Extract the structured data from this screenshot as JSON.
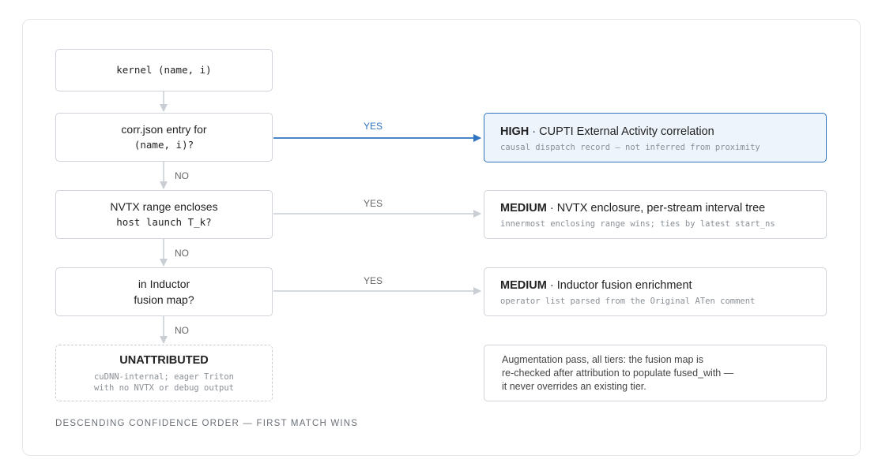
{
  "decisions": [
    {
      "line1": "kernel (name, i)",
      "line2": ""
    },
    {
      "line1": "corr.json entry for",
      "line2": "(name, i)?"
    },
    {
      "line1": "NVTX range encloses",
      "line2": "host launch T_k?"
    },
    {
      "line1": "in Inductor",
      "line2": "fusion map?"
    }
  ],
  "results": [
    {
      "tier": "HIGH",
      "sep": " · ",
      "title": "CUPTI External Activity correlation",
      "sub": "causal dispatch record — not inferred from proximity"
    },
    {
      "tier": "MEDIUM",
      "sep": " · ",
      "title": "NVTX enclosure, per-stream interval tree",
      "sub": "innermost enclosing range wins; ties by latest start_ns"
    },
    {
      "tier": "MEDIUM",
      "sep": " · ",
      "title": "Inductor fusion enrichment",
      "sub": "operator list parsed from the Original ATen comment"
    }
  ],
  "unattributed": {
    "title": "UNATTRIBUTED",
    "line1": "cuDNN-internal; eager Triton",
    "line2": "with no NVTX or debug output"
  },
  "note": {
    "line1": "Augmentation pass, all tiers: the fusion map is",
    "line2": "re-checked after attribution to populate fused_with —",
    "line3": "it never overrides an existing tier."
  },
  "labels": {
    "yes": "YES",
    "no": "NO"
  },
  "footer": "DESCENDING CONFIDENCE ORDER — FIRST MATCH WINS",
  "colors": {
    "accent": "#2f74c0",
    "accent_bg": "#edf4fc",
    "border": "#cfd4da",
    "connector": "#c9ced4"
  }
}
